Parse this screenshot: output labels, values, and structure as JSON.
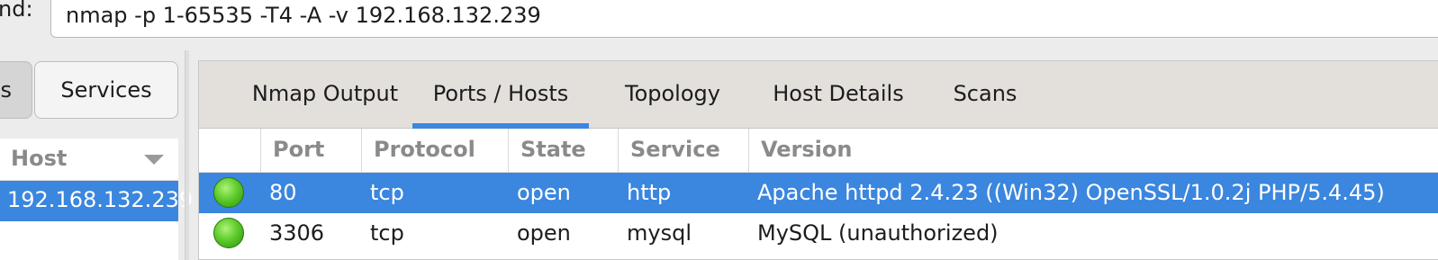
{
  "command": {
    "label": "nd:",
    "value": "nmap -p 1-65535 -T4 -A -v 192.168.132.239"
  },
  "left_pane": {
    "tabs": [
      {
        "label": "s",
        "active": false
      },
      {
        "label": "Services",
        "active": false
      }
    ],
    "host_column_header": "Host",
    "hosts": [
      {
        "address": "192.168.132.239",
        "selected": true
      }
    ]
  },
  "main_tabs": [
    {
      "label": "Nmap Output",
      "active": false
    },
    {
      "label": "Ports / Hosts",
      "active": true
    },
    {
      "label": "Topology",
      "active": false
    },
    {
      "label": "Host Details",
      "active": false
    },
    {
      "label": "Scans",
      "active": false
    }
  ],
  "ports_table": {
    "columns": [
      "Port",
      "Protocol",
      "State",
      "Service",
      "Version"
    ],
    "rows": [
      {
        "status_icon": "green-circle-icon",
        "port": "80",
        "protocol": "tcp",
        "state": "open",
        "service": "http",
        "version": "Apache httpd 2.4.23 ((Win32) OpenSSL/1.0.2j PHP/5.4.45)",
        "selected": true
      },
      {
        "status_icon": "green-circle-icon",
        "port": "3306",
        "protocol": "tcp",
        "state": "open",
        "service": "mysql",
        "version": "MySQL (unauthorized)",
        "selected": false
      }
    ]
  },
  "colors": {
    "selection": "#3b86de",
    "status_open": "#5fcc2c",
    "tab_strip": "#e3e0dc"
  }
}
